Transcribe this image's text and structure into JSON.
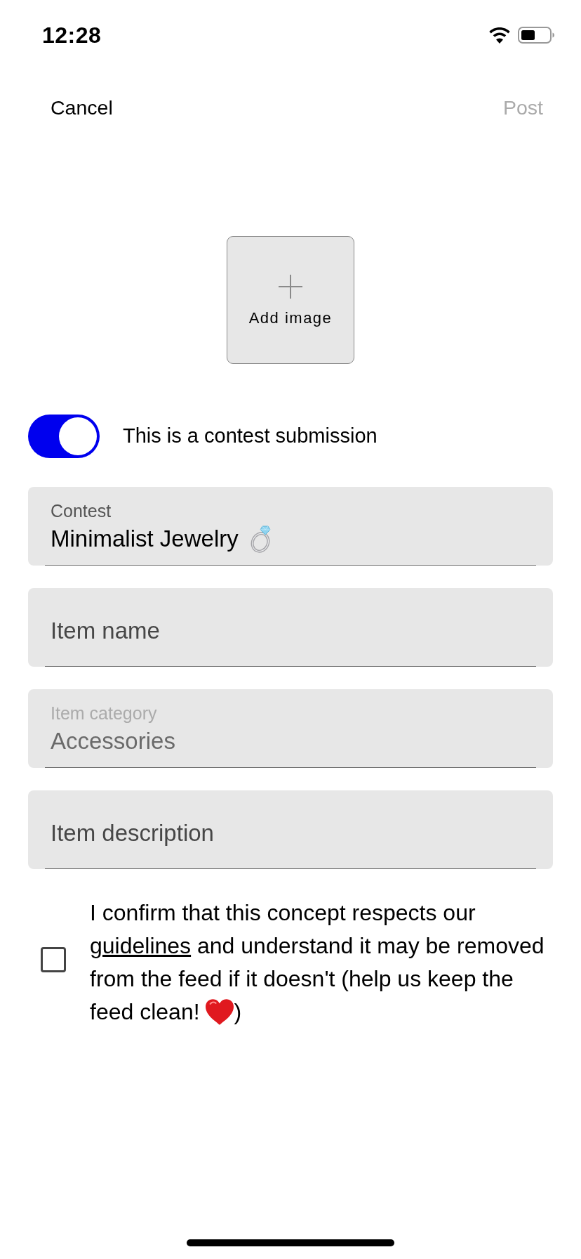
{
  "status_bar": {
    "time": "12:28"
  },
  "nav": {
    "cancel": "Cancel",
    "post": {
      "label": "Post",
      "disabled": true
    }
  },
  "add_image": {
    "label": "Add image"
  },
  "contest_toggle": {
    "label": "This is a contest submission",
    "on": true
  },
  "fields": [
    {
      "kind": "contest",
      "label": "Contest",
      "value": "Minimalist Jewelry",
      "disabled": false
    },
    {
      "kind": "text",
      "placeholder": "Item name",
      "disabled": false
    },
    {
      "kind": "category",
      "label": "Item category",
      "value": "Accessories",
      "disabled": true
    },
    {
      "kind": "text",
      "placeholder": "Item description",
      "disabled": false
    }
  ],
  "confirm": {
    "text_before": "I confirm that this concept respects our",
    "link": "guidelines",
    "text_after": "and understand it may be removed from the feed if it doesn't (help us keep the feed clean!",
    "text_end": ")",
    "checked": false
  }
}
